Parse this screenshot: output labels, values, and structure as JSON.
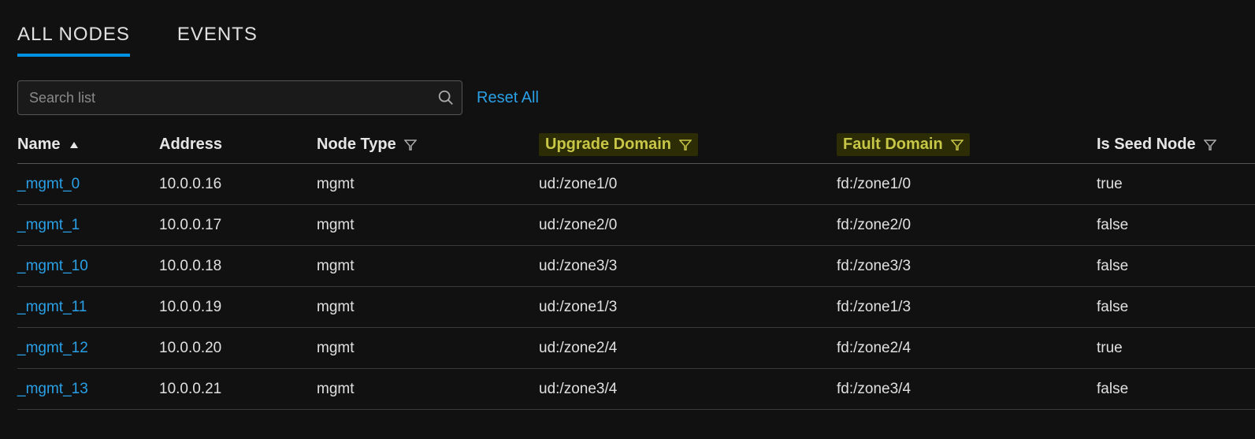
{
  "tabs": {
    "all_nodes": "ALL NODES",
    "events": "EVENTS"
  },
  "toolbar": {
    "search_placeholder": "Search list",
    "reset_label": "Reset All"
  },
  "columns": {
    "name": "Name",
    "address": "Address",
    "node_type": "Node Type",
    "upgrade_domain": "Upgrade Domain",
    "fault_domain": "Fault Domain",
    "is_seed_node": "Is Seed Node"
  },
  "rows": [
    {
      "name": "_mgmt_0",
      "address": "10.0.0.16",
      "node_type": "mgmt",
      "upgrade_domain": "ud:/zone1/0",
      "fault_domain": "fd:/zone1/0",
      "is_seed_node": "true"
    },
    {
      "name": "_mgmt_1",
      "address": "10.0.0.17",
      "node_type": "mgmt",
      "upgrade_domain": "ud:/zone2/0",
      "fault_domain": "fd:/zone2/0",
      "is_seed_node": "false"
    },
    {
      "name": "_mgmt_10",
      "address": "10.0.0.18",
      "node_type": "mgmt",
      "upgrade_domain": "ud:/zone3/3",
      "fault_domain": "fd:/zone3/3",
      "is_seed_node": "false"
    },
    {
      "name": "_mgmt_11",
      "address": "10.0.0.19",
      "node_type": "mgmt",
      "upgrade_domain": "ud:/zone1/3",
      "fault_domain": "fd:/zone1/3",
      "is_seed_node": "false"
    },
    {
      "name": "_mgmt_12",
      "address": "10.0.0.20",
      "node_type": "mgmt",
      "upgrade_domain": "ud:/zone2/4",
      "fault_domain": "fd:/zone2/4",
      "is_seed_node": "true"
    },
    {
      "name": "_mgmt_13",
      "address": "10.0.0.21",
      "node_type": "mgmt",
      "upgrade_domain": "ud:/zone3/4",
      "fault_domain": "fd:/zone3/4",
      "is_seed_node": "false"
    }
  ]
}
